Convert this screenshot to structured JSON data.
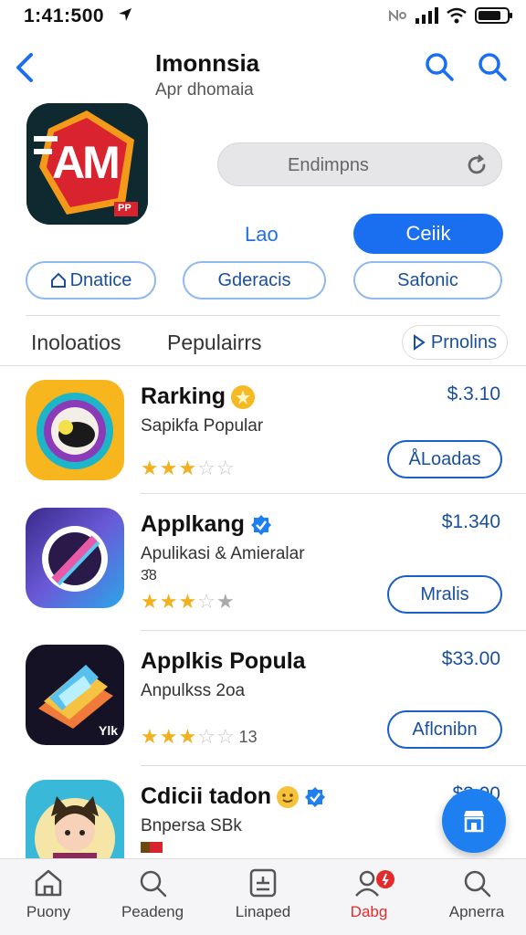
{
  "status": {
    "time": "1:41:500"
  },
  "nav": {
    "title": "Imonnsia",
    "subtitle": "Apr dhomaia"
  },
  "app": {
    "icon_text": "AM",
    "icon_small": "PP",
    "refresh_label": "Endimpns",
    "secondary_link": "Lao",
    "primary_button": "Ceiik",
    "chips": [
      "Dnatice",
      "Gderacis",
      "Safonic"
    ]
  },
  "tabs": {
    "tab1": "Inoloatios",
    "tab2": "Pepulairrs",
    "promo": "Prnolins"
  },
  "list": [
    {
      "title": "Rarking",
      "subtitle": "Sapikfa Popular",
      "price": "$.3.10",
      "button": "ÅLoadas",
      "rating": 3,
      "rating_text": ""
    },
    {
      "title": "Applkang",
      "subtitle": "Apulikasi & Amieralar",
      "subtitle2": "3̂8",
      "price": "$1.340",
      "button": "Mralis",
      "rating": 3,
      "rating_text": ""
    },
    {
      "title": "Applkis Popula",
      "subtitle": "Anpulkss 2oa",
      "price": "$33.00",
      "button": "Aflcnibn",
      "rating": 3,
      "rating_text": "13",
      "icon_text": "Ylk"
    },
    {
      "title": "Cdicii tadon",
      "subtitle": "Bnpersa SBk",
      "price": "$3.00"
    }
  ],
  "tabbar": [
    {
      "label": "Puony",
      "icon": "home-icon"
    },
    {
      "label": "Peadeng",
      "icon": "search-icon"
    },
    {
      "label": "Linaped",
      "icon": "list-icon"
    },
    {
      "label": "Dabg",
      "icon": "person-icon"
    },
    {
      "label": "Apnerra",
      "icon": "search-icon"
    }
  ],
  "colors": {
    "accent": "#1a6ff0",
    "active_tab": "#e32b2b",
    "star": "#f2b01e"
  }
}
